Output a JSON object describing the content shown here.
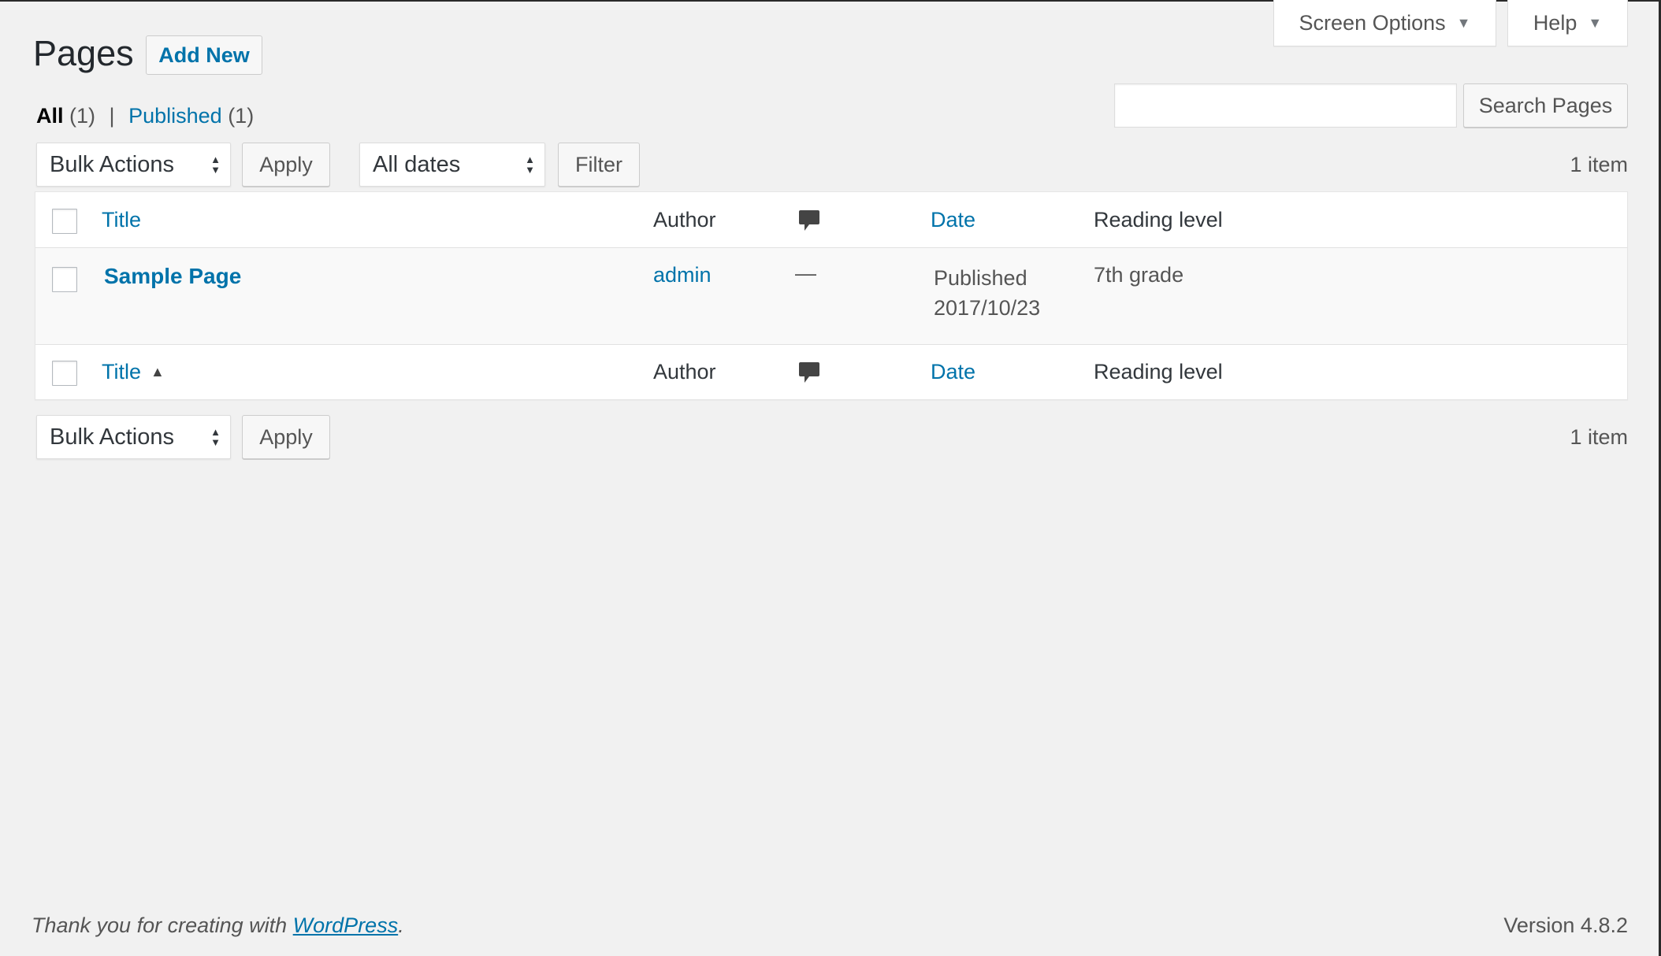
{
  "header": {
    "title": "Pages",
    "add_new": "Add New",
    "screen_options": "Screen Options",
    "help": "Help"
  },
  "views": {
    "all_label": "All",
    "all_count": "(1)",
    "separator": "|",
    "published_label": "Published",
    "published_count": "(1)"
  },
  "search": {
    "value": "",
    "placeholder": "",
    "button": "Search Pages"
  },
  "top_nav": {
    "bulk_actions": "Bulk Actions",
    "apply": "Apply",
    "dates": "All dates",
    "filter": "Filter",
    "count": "1 item"
  },
  "bottom_nav": {
    "bulk_actions": "Bulk Actions",
    "apply": "Apply",
    "count": "1 item"
  },
  "table": {
    "columns": {
      "title": "Title",
      "author": "Author",
      "date": "Date",
      "reading_level": "Reading level"
    },
    "rows": [
      {
        "title": "Sample Page",
        "author": "admin",
        "comments": "—",
        "date_status": "Published",
        "date_value": "2017/10/23",
        "reading_level": "7th grade"
      }
    ]
  },
  "footer": {
    "thanks_prefix": "Thank you for creating with ",
    "thanks_link": "WordPress",
    "thanks_suffix": ".",
    "version": "Version 4.8.2"
  },
  "colors": {
    "background": "#f1f1f1",
    "link": "#0073aa",
    "text": "#23282d"
  }
}
